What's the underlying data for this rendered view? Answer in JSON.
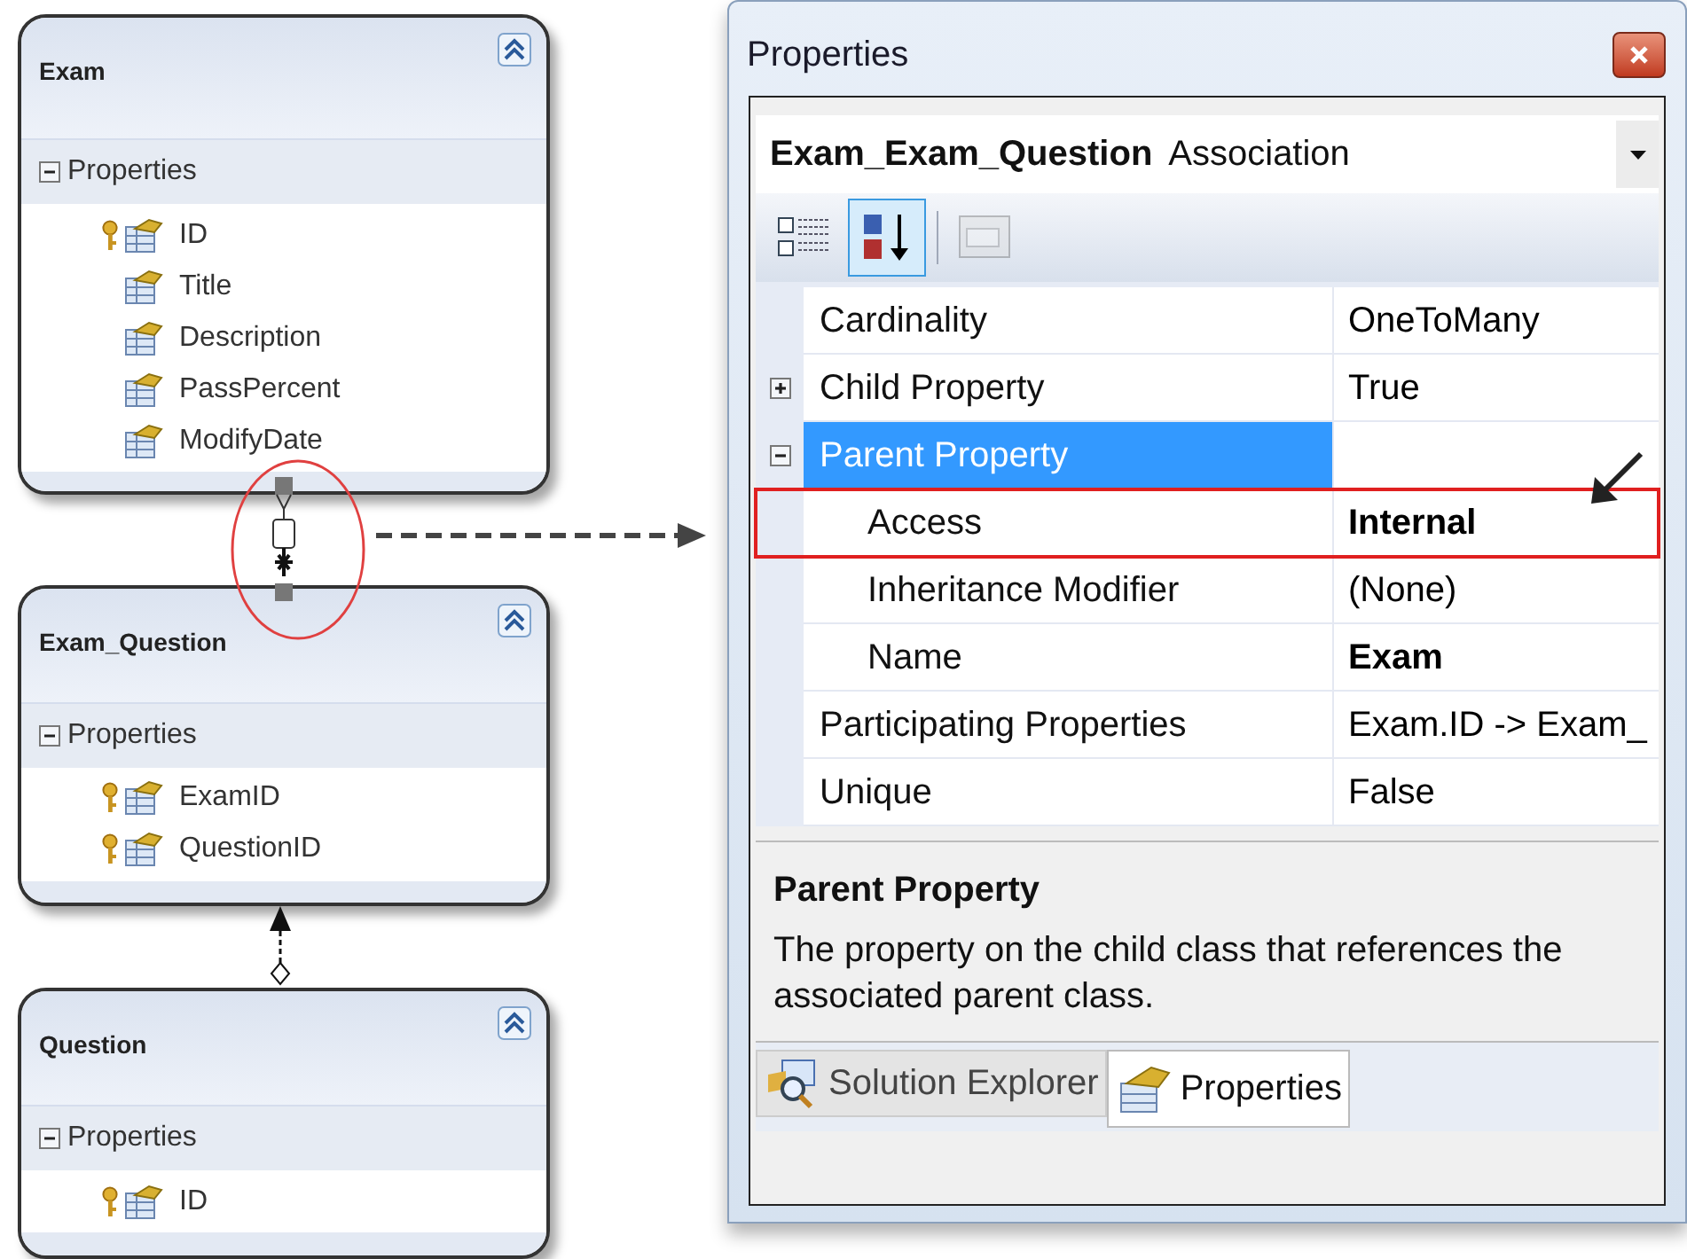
{
  "diagram": {
    "entities": [
      {
        "name": "Exam",
        "section": {
          "label": "Properties",
          "expanded": true
        },
        "fields": [
          {
            "name": "ID",
            "key": true
          },
          {
            "name": "Title",
            "key": false
          },
          {
            "name": "Description",
            "key": false
          },
          {
            "name": "PassPercent",
            "key": false
          },
          {
            "name": "ModifyDate",
            "key": false
          }
        ]
      },
      {
        "name": "Exam_Question",
        "section": {
          "label": "Properties",
          "expanded": true
        },
        "fields": [
          {
            "name": "ExamID",
            "key": true
          },
          {
            "name": "QuestionID",
            "key": true
          }
        ]
      },
      {
        "name": "Question",
        "section": {
          "label": "Properties",
          "expanded": true
        },
        "fields": [
          {
            "name": "ID",
            "key": true
          }
        ]
      }
    ]
  },
  "properties_window": {
    "title": "Properties",
    "object": {
      "name": "Exam_Exam_Question",
      "type": "Association"
    },
    "toolbar": [
      {
        "kind": "categorized",
        "selected": false,
        "disabled": false
      },
      {
        "kind": "alphabetical",
        "selected": true,
        "disabled": false
      },
      {
        "kind": "pages",
        "selected": false,
        "disabled": true
      }
    ],
    "rows": [
      {
        "name": "Cardinality",
        "value": "OneToMany",
        "bold": false,
        "selected": false,
        "highlighted": false
      },
      {
        "name": "Child Property",
        "value": "True",
        "bold": false,
        "selected": false,
        "highlighted": false,
        "expanded": false
      },
      {
        "name": "Parent Property",
        "bold": false,
        "selected": true,
        "highlighted": false,
        "expanded": true,
        "children": [
          {
            "name": "Access",
            "value": "Internal",
            "bold": true,
            "selected": false,
            "highlighted": true
          },
          {
            "name": "Inheritance Modifier",
            "value": "(None)",
            "bold": false,
            "selected": false,
            "highlighted": false
          },
          {
            "name": "Name",
            "value": "Exam",
            "bold": true,
            "selected": false,
            "highlighted": false
          }
        ]
      },
      {
        "name": "Participating Properties",
        "value": "Exam.ID -> Exam_",
        "bold": false,
        "selected": false,
        "highlighted": false
      },
      {
        "name": "Unique",
        "value": "False",
        "bold": false,
        "selected": false,
        "highlighted": false
      }
    ],
    "description": {
      "title": "Parent Property",
      "text": "The property on the child class that references the associated parent class."
    },
    "tabs": [
      {
        "label": "Solution Explorer",
        "kind": "solution",
        "selected": false
      },
      {
        "label": "Properties",
        "kind": "properties",
        "selected": true
      }
    ]
  }
}
